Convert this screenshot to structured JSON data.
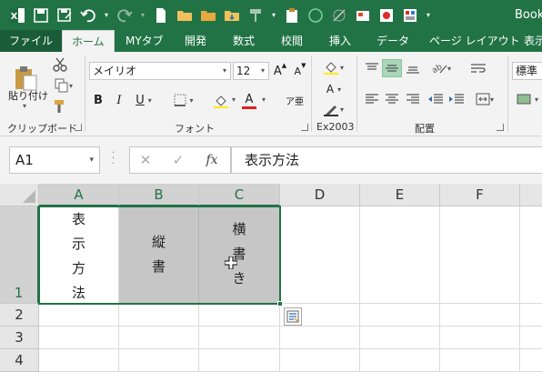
{
  "window": {
    "book_title": "Book"
  },
  "tabs": [
    "ファイル",
    "ホーム",
    "MYタブ",
    "開発",
    "数式",
    "校閲",
    "挿入",
    "データ",
    "ページ レイアウト",
    "表示"
  ],
  "ribbon": {
    "clipboard": {
      "paste_label": "貼り付け",
      "group_label": "クリップボード"
    },
    "font": {
      "family": "メイリオ",
      "size": "12",
      "group_label": "フォント"
    },
    "ex2003": {
      "group_label": "Ex2003"
    },
    "alignment": {
      "group_label": "配置"
    },
    "number": {
      "format": "標準"
    }
  },
  "formula_bar": {
    "name_box": "A1",
    "formula": "表示方法"
  },
  "grid": {
    "columns": [
      "A",
      "B",
      "C",
      "D",
      "E",
      "F"
    ],
    "rows": [
      "1",
      "2",
      "3",
      "4"
    ],
    "cells": {
      "A1": [
        "表",
        "示",
        "方",
        "法"
      ],
      "B1": [
        "縦",
        "書"
      ],
      "C1": [
        "横",
        "書",
        "き"
      ]
    }
  },
  "colors": {
    "accent": "#217346",
    "selection_fill": "#c6c6c6"
  }
}
